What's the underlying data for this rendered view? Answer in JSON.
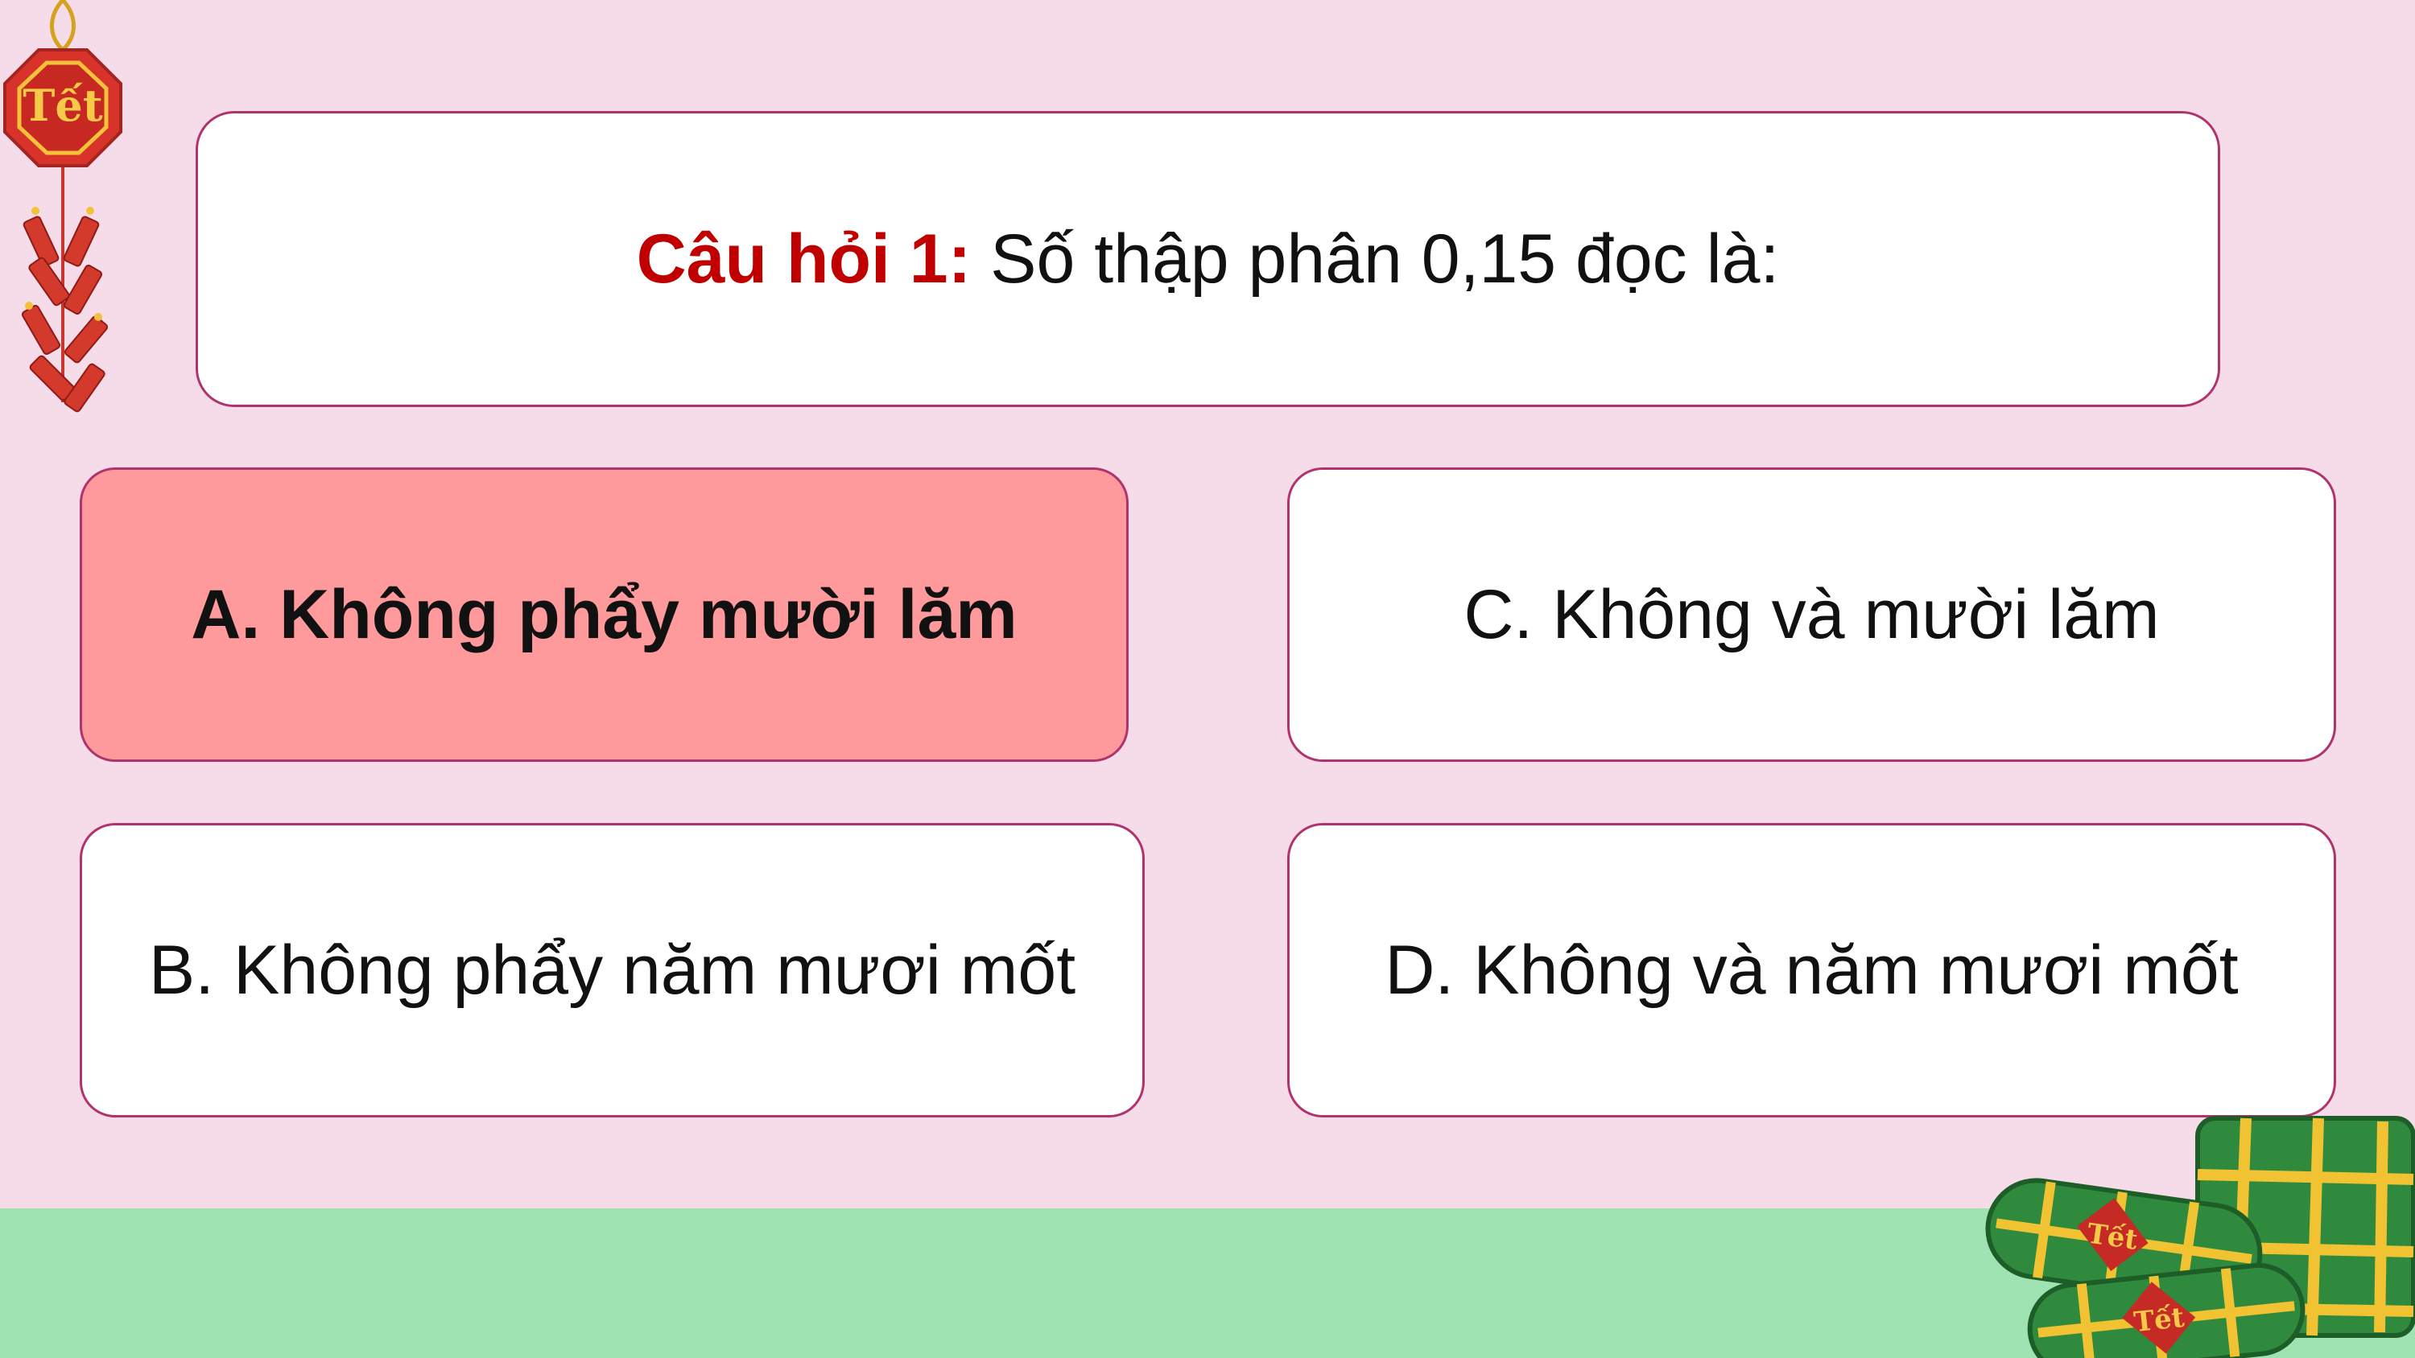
{
  "question": {
    "prefix": "Câu hỏi 1:",
    "text": " Số thập phân 0,15 đọc là:"
  },
  "answers": {
    "a": {
      "label": "A. Không phẩy mười lăm",
      "selected": true
    },
    "b": {
      "label": "B. Không phẩy năm mươi mốt",
      "selected": false
    },
    "c": {
      "label": "C. Không và mười lăm",
      "selected": false
    },
    "d": {
      "label": "D. Không và năm mươi mốt",
      "selected": false
    }
  },
  "decorations": {
    "firecracker_badge": "Tết",
    "banhchung_labels": [
      "Tết",
      "Tết"
    ]
  },
  "colors": {
    "background": "#f6dbe9",
    "ground": "#9fe3b3",
    "card_border": "#b0336e",
    "selected_answer": "#fe9a9c",
    "question_prefix": "#c00000"
  }
}
